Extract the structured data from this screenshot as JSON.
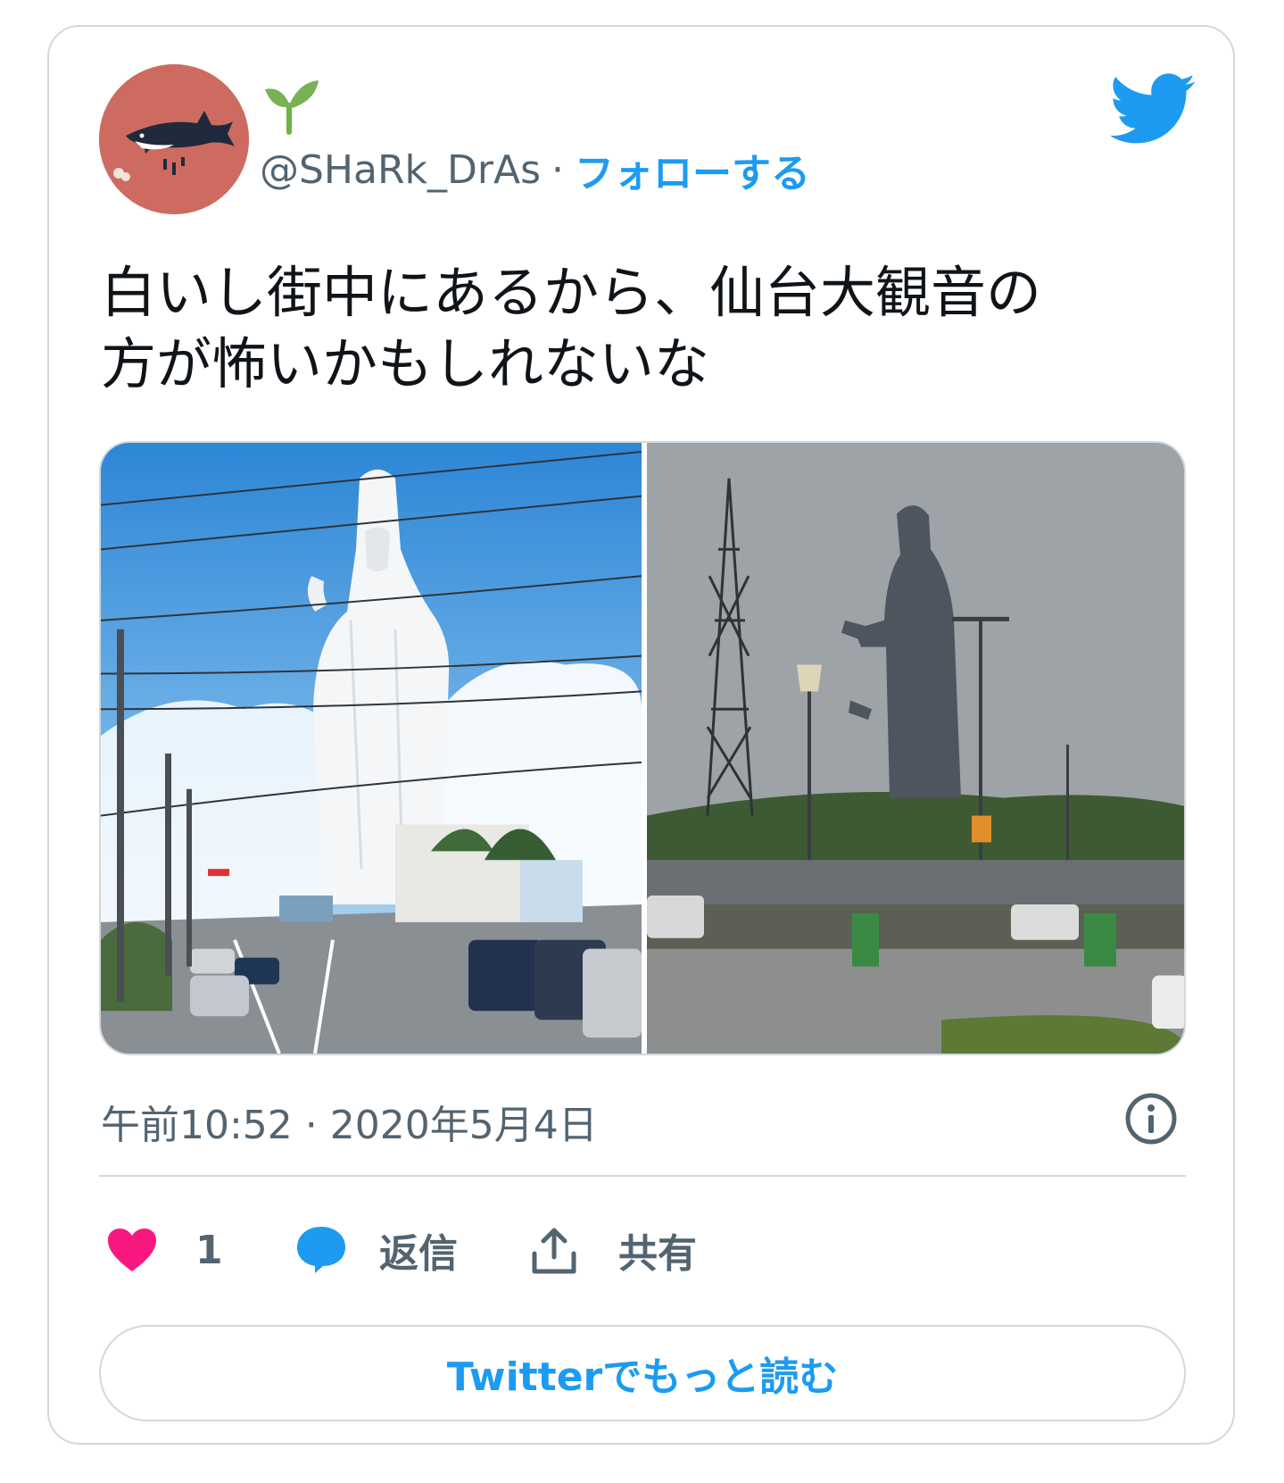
{
  "user": {
    "handle": "@SHaRk_DrAs",
    "separator": "·",
    "follow_label": "フォローする",
    "name_emoji": "seedling-icon",
    "avatar_bg": "#cd6b60"
  },
  "tweet": {
    "text": "白いし街中にあるから、仙台大観音の\n方が怖いかもしれないな"
  },
  "media": {
    "photos": [
      "white-kannon-statue-photo",
      "dark-buddha-statue-photo"
    ]
  },
  "meta": {
    "timestamp": "午前10:52 · 2020年5月4日"
  },
  "actions": {
    "like_count": "1",
    "reply_label": "返信",
    "share_label": "共有"
  },
  "more_button": {
    "label": "Twitterでもっと読む"
  },
  "colors": {
    "accent": "#1d9bf0",
    "like": "#f91880",
    "muted": "#536471",
    "border": "#cfd9de"
  }
}
